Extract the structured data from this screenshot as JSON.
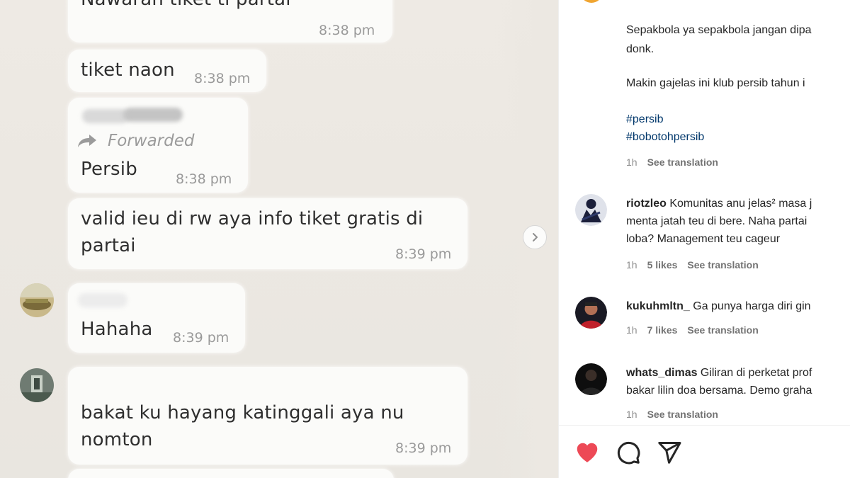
{
  "chat": {
    "messages": [
      {
        "text": "Nawaran tiket ti partai",
        "time": "8:38 pm"
      },
      {
        "text": "tiket naon",
        "time": "8:38 pm"
      },
      {
        "forwarded_label": "Forwarded",
        "text": "Persib",
        "time": "8:38 pm"
      },
      {
        "line1": "valid ieu di rw aya info tiket gratis di",
        "line2": "partai",
        "time": "8:39 pm"
      },
      {
        "text": "Hahaha",
        "time": "8:39 pm"
      },
      {
        "line1": "bakat ku hayang katinggali aya nu",
        "line2": "nomton",
        "time": "8:39 pm"
      }
    ]
  },
  "post": {
    "caption": {
      "line1": "Sepakbola ya sepakbola jangan dipa",
      "line2": "donk.",
      "line3": "Makin gajelas ini klub persib tahun i",
      "hashtag1": "#persib",
      "hashtag2": "#bobotohpersib",
      "time": "1h",
      "see_translation": "See translation"
    },
    "comments": [
      {
        "username": "riotzleo",
        "line1": " Komunitas anu jelas² masa j",
        "line2": "menta jatah teu di bere. Naha partai",
        "line3": "loba? Management teu cageur",
        "time": "1h",
        "likes": "5 likes",
        "see_translation": "See translation"
      },
      {
        "username": "kukuhmltn_",
        "line1": " Ga punya harga diri gin",
        "time": "1h",
        "likes": "7 likes",
        "see_translation": "See translation"
      },
      {
        "username": "whats_dimas",
        "line1": " Giliran di perketat prof",
        "line2": "bakar lilin doa bersama. Demo graha",
        "time": "1h",
        "see_translation": "See translation"
      }
    ]
  },
  "colors": {
    "like_red": "#ed4956",
    "hashtag_blue": "#00376b",
    "meta_gray": "#8e8e8e"
  },
  "icons": [
    "heart-icon",
    "comment-icon",
    "share-icon",
    "chevron-right-icon"
  ]
}
